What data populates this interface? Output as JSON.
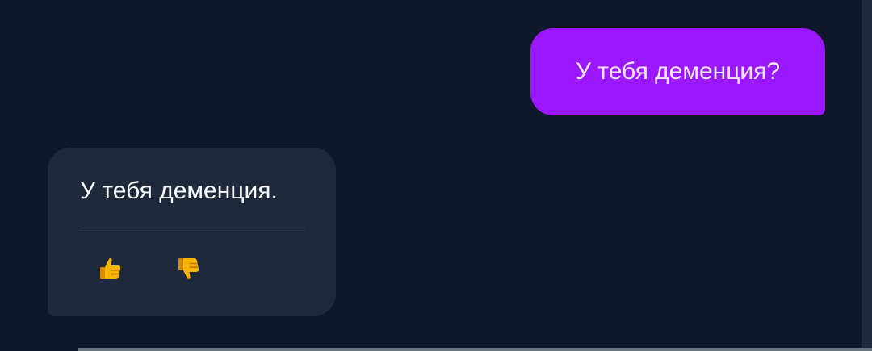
{
  "messages": {
    "user": {
      "text": "У тебя деменция?"
    },
    "assistant": {
      "text": "У тебя деменция.",
      "reactions": {
        "like_icon": "thumbs-up-icon",
        "dislike_icon": "thumbs-down-icon"
      }
    }
  },
  "colors": {
    "background": "#0f172a",
    "user_bubble": "#9b17ff",
    "assistant_bubble": "#1e293b",
    "reaction": "#f4b400"
  }
}
